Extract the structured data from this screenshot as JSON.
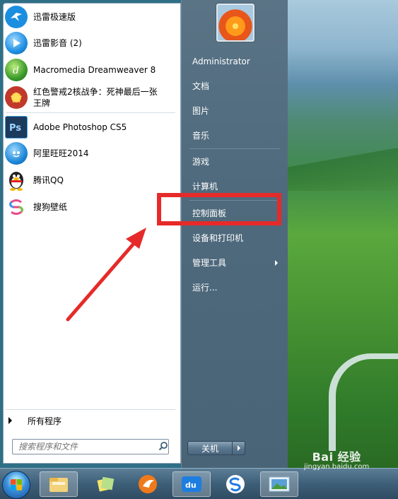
{
  "start_menu": {
    "programs": [
      {
        "label": "迅雷极速版",
        "icon": "xunlei-bird-icon",
        "color": "#1b8ee0"
      },
      {
        "label": "迅雷影音 (2)",
        "icon": "xunlei-player-icon",
        "color": "#1e8fe2"
      },
      {
        "label": "Macromedia Dreamweaver 8",
        "icon": "dreamweaver-icon",
        "color": "#3a9a2a"
      },
      {
        "label": "红色警戒2核战争：死神最后一张王牌",
        "icon": "red-alert-icon",
        "color": "#c0392b"
      },
      {
        "label": "Adobe Photoshop CS5",
        "icon": "photoshop-icon",
        "color": "#1c3a5c"
      },
      {
        "label": "阿里旺旺2014",
        "icon": "aliwangwang-icon",
        "color": "#1e88d8"
      },
      {
        "label": "腾讯QQ",
        "icon": "qq-penguin-icon",
        "color": "#222222"
      },
      {
        "label": "搜狗壁纸",
        "icon": "sogou-wallpaper-icon",
        "color": "#e84a8a"
      }
    ],
    "all_programs": "所有程序",
    "search_placeholder": "搜索程序和文件",
    "right_panel": [
      {
        "label": "Administrator"
      },
      {
        "label": "文档"
      },
      {
        "label": "图片"
      },
      {
        "label": "音乐"
      },
      {
        "label": "游戏"
      },
      {
        "label": "计算机"
      },
      {
        "label": "控制面板"
      },
      {
        "label": "设备和打印机"
      },
      {
        "label": "管理工具"
      },
      {
        "label": "运行..."
      }
    ],
    "shutdown_label": "关机"
  },
  "watermark": {
    "brand": "Bai 经验",
    "url": "jingyan.baidu.com"
  },
  "colors": {
    "highlight": "#e62a2a"
  }
}
